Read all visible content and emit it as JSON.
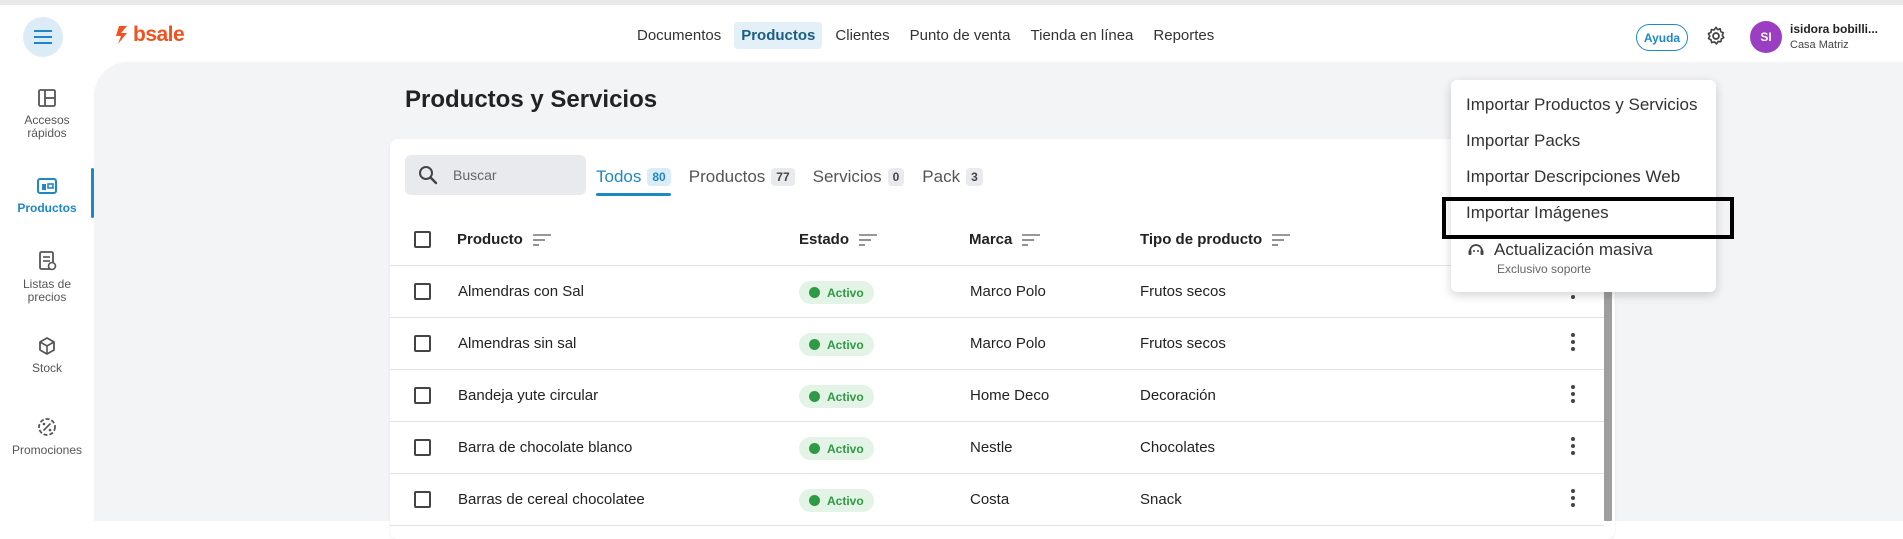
{
  "header": {
    "logo_text": "bsale",
    "nav": [
      "Documentos",
      "Productos",
      "Clientes",
      "Punto de venta",
      "Tienda en línea",
      "Reportes"
    ],
    "active_nav": "Productos",
    "help_label": "Ayuda",
    "avatar_initials": "SI",
    "user_name": "isidora bobilli...",
    "user_branch": "Casa Matriz"
  },
  "sidebar": {
    "items": [
      {
        "label_line1": "Accesos",
        "label_line2": "rápidos"
      },
      {
        "label_line1": "Productos",
        "label_line2": ""
      },
      {
        "label_line1": "Listas de",
        "label_line2": "precios"
      },
      {
        "label_line1": "Stock",
        "label_line2": ""
      },
      {
        "label_line1": "Promociones",
        "label_line2": ""
      }
    ],
    "active": "Productos"
  },
  "page": {
    "title": "Productos y Servicios",
    "search_placeholder": "Buscar",
    "tabs": [
      {
        "label": "Todos",
        "count": "80"
      },
      {
        "label": "Productos",
        "count": "77"
      },
      {
        "label": "Servicios",
        "count": "0"
      },
      {
        "label": "Pack",
        "count": "3"
      }
    ],
    "active_tab": "Todos"
  },
  "table": {
    "headers": {
      "producto": "Producto",
      "estado": "Estado",
      "marca": "Marca",
      "tipo": "Tipo de producto"
    },
    "rows": [
      {
        "producto": "Almendras con Sal",
        "estado": "Activo",
        "marca": "Marco Polo",
        "tipo": "Frutos secos"
      },
      {
        "producto": "Almendras sin sal",
        "estado": "Activo",
        "marca": "Marco Polo",
        "tipo": "Frutos secos"
      },
      {
        "producto": "Bandeja yute circular",
        "estado": "Activo",
        "marca": "Home Deco",
        "tipo": "Decoración"
      },
      {
        "producto": "Barra de chocolate blanco",
        "estado": "Activo",
        "marca": "Nestle",
        "tipo": "Chocolates"
      },
      {
        "producto": "Barras de cereal chocolatee",
        "estado": "Activo",
        "marca": "Costa",
        "tipo": "Snack"
      }
    ]
  },
  "dropdown": {
    "items": [
      "Importar Productos y Servicios",
      "Importar Packs",
      "Importar Descripciones Web",
      "Importar Imágenes",
      "Actualización masiva"
    ],
    "last_item_sub": "Exclusivo soporte",
    "highlighted": "Importar Imágenes"
  },
  "colors": {
    "accent": "#1e88c7",
    "brand": "#f4511e",
    "active_badge": "#2e9a45",
    "avatar": "#9b3fc2"
  }
}
